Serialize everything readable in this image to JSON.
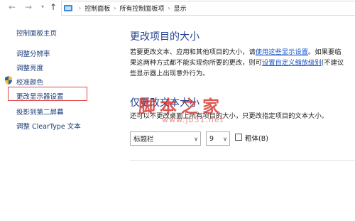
{
  "breadcrumb": [
    "控制面板",
    "所有控制面板项",
    "显示"
  ],
  "icons": {
    "back": "arrow-left-icon",
    "forward": "arrow-right-icon",
    "up": "arrow-up-icon",
    "location": "control-panel-icon",
    "shield": "uac-shield-icon"
  },
  "sidebar": {
    "home": "控制面板主页",
    "items": [
      "调整分辨率",
      "调整亮度",
      "校准颜色",
      "更改显示器设置",
      "投影到第二屏幕",
      "调整 ClearType 文本"
    ],
    "highlighted_index": 3
  },
  "section1": {
    "title": "更改项目的大小",
    "line1_before": "若要更改文本、应用和其他项目的大小，请",
    "line1_link": "使用这些显示设置",
    "line1_after": "。如果要临",
    "line2_before": "果这两种方式都不能实现你所要的更改，则可",
    "line2_link": "设置自定义缩放级别",
    "line2_after": "(不建议",
    "line3": "些显示器上出现意外行为。"
  },
  "section2": {
    "title": "仅更改文本大小",
    "subtitle": "还可以不更改桌面上所有项目的大小，只更改指定项目的文本大小。",
    "item_select": "标题栏",
    "size_select": "9",
    "bold_label": "粗体(B)",
    "bold_checked": false
  },
  "watermark": {
    "text": "脚本之家",
    "url": "www.jb51.net"
  },
  "colors": {
    "link": "#1a55c8",
    "heading": "#1f3f8f",
    "highlight_box": "#e34848",
    "watermark": "#d62a24"
  }
}
